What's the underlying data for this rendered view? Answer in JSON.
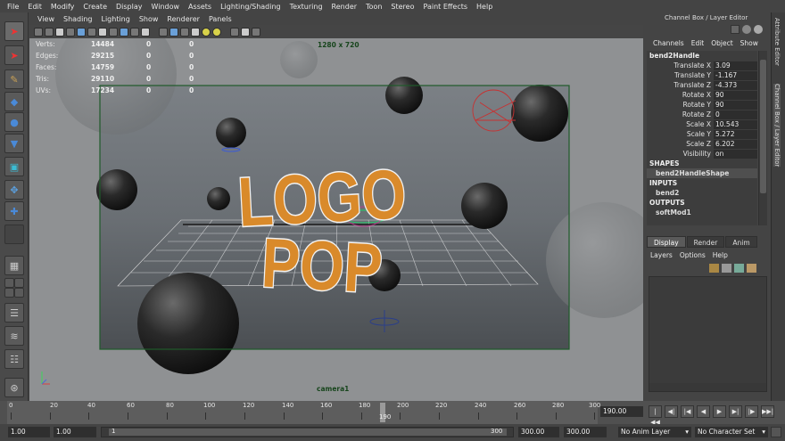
{
  "menus": [
    "File",
    "Edit",
    "Modify",
    "Create",
    "Display",
    "Window",
    "Assets",
    "Lighting/Shading",
    "Texturing",
    "Render",
    "Toon",
    "Stereo",
    "Paint Effects",
    "Help"
  ],
  "viewport_menus": [
    "View",
    "Shading",
    "Lighting",
    "Show",
    "Renderer",
    "Panels"
  ],
  "hud": {
    "rows": [
      {
        "label": "Verts:",
        "value": "14484",
        "a": "0",
        "b": "0"
      },
      {
        "label": "Edges:",
        "value": "29215",
        "a": "0",
        "b": "0"
      },
      {
        "label": "Faces:",
        "value": "14759",
        "a": "0",
        "b": "0"
      },
      {
        "label": "Tris:",
        "value": "29110",
        "a": "0",
        "b": "0"
      },
      {
        "label": "UVs:",
        "value": "17234",
        "a": "0",
        "b": "0"
      }
    ],
    "resolution": "1280 x 720",
    "camera": "camera1"
  },
  "scene": {
    "logo_line1": "LOGO",
    "logo_line2": "POP",
    "logo_color": "#d98a2b",
    "frame_color": "#1f5a2a"
  },
  "channel_box": {
    "title": "Channel Box / Layer Editor",
    "menu": [
      "Channels",
      "Edit",
      "Object",
      "Show"
    ],
    "object": "bend2Handle",
    "attributes": [
      {
        "name": "Translate X",
        "value": "3.09"
      },
      {
        "name": "Translate Y",
        "value": "-1.167"
      },
      {
        "name": "Translate Z",
        "value": "-4.373"
      },
      {
        "name": "Rotate X",
        "value": "90"
      },
      {
        "name": "Rotate Y",
        "value": "90"
      },
      {
        "name": "Rotate Z",
        "value": "0"
      },
      {
        "name": "Scale X",
        "value": "10.543"
      },
      {
        "name": "Scale Y",
        "value": "5.272"
      },
      {
        "name": "Scale Z",
        "value": "6.202"
      },
      {
        "name": "Visibility",
        "value": "on"
      }
    ],
    "shapes_label": "SHAPES",
    "shape": "bend2HandleShape",
    "inputs_label": "INPUTS",
    "input": "bend2",
    "outputs_label": "OUTPUTS",
    "output": "softMod1"
  },
  "layer_editor": {
    "tabs": [
      "Display",
      "Render",
      "Anim"
    ],
    "active_tab": "Display",
    "menu": [
      "Layers",
      "Options",
      "Help"
    ]
  },
  "side_tabs": [
    "Attribute Editor",
    "Channel Box / Layer Editor"
  ],
  "timeline": {
    "ticks": [
      "0",
      "20",
      "40",
      "60",
      "80",
      "100",
      "120",
      "140",
      "160",
      "180",
      "200",
      "220",
      "240",
      "260",
      "280",
      "300"
    ],
    "current_marker": "190",
    "current_frame": "190.00"
  },
  "range": {
    "start": "1.00",
    "playback_start": "1.00",
    "slider_start": "1",
    "slider_end": "300",
    "playback_end": "300.00",
    "end": "300.00",
    "anim_layer": "No Anim Layer",
    "character_set": "No Character Set"
  }
}
